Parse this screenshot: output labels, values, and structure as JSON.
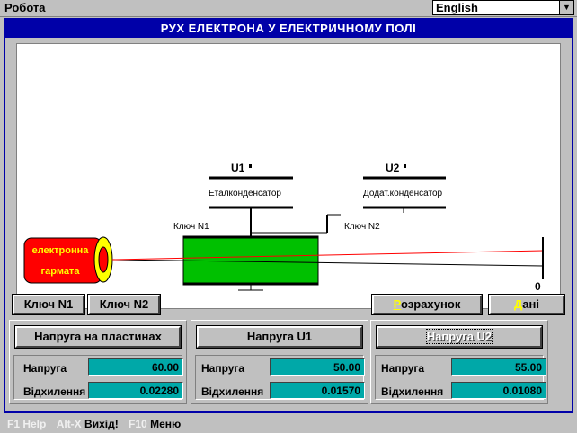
{
  "menu": {
    "item_label": "Робота"
  },
  "language": {
    "value": "English"
  },
  "window": {
    "title": "РУХ ЕЛЕКТРОНА У ЕЛЕКТРИЧНОМУ ПОЛІ"
  },
  "diagram": {
    "u1_label": "U1",
    "u1_caption": "Еталконденсатор",
    "u2_label": "U2",
    "u2_caption": "Додат.конденсатор",
    "key1_label": "Ключ  N1",
    "key2_label": "Ключ  N2",
    "gun_line1": "електронна",
    "gun_line2": "гармата",
    "screen_zero": "0"
  },
  "buttons": {
    "key1": "Ключ N1",
    "key2": "Ключ N2",
    "calc_hot": "Р",
    "calc_rest": "озрахунок",
    "data_hot": "Д",
    "data_rest": "ані"
  },
  "panels": [
    {
      "button": "Напруга на пластинах",
      "voltage_label": "Напруга",
      "voltage": "60.00",
      "deflection_label": "Відхилення",
      "deflection": "0.02280"
    },
    {
      "button": "Напруга U1",
      "voltage_label": "Напруга",
      "voltage": "50.00",
      "deflection_label": "Відхилення",
      "deflection": "0.01570"
    },
    {
      "button": "Напруга U2",
      "voltage_label": "Напруга",
      "voltage": "55.00",
      "deflection_label": "Відхилення",
      "deflection": "0.01080"
    }
  ],
  "status": {
    "f1_key": "F1 Help",
    "altx_key": "Alt-X",
    "altx_text": "Вихід!",
    "f10_key": "F10",
    "f10_text": "Меню"
  },
  "colors": {
    "title_bg": "#0000a8",
    "plate_fill": "#00c000",
    "gun_fill": "#ff0000",
    "gun_ring": "#ffff00",
    "value_bg": "#00a8a8",
    "beam": "#ff0000"
  }
}
